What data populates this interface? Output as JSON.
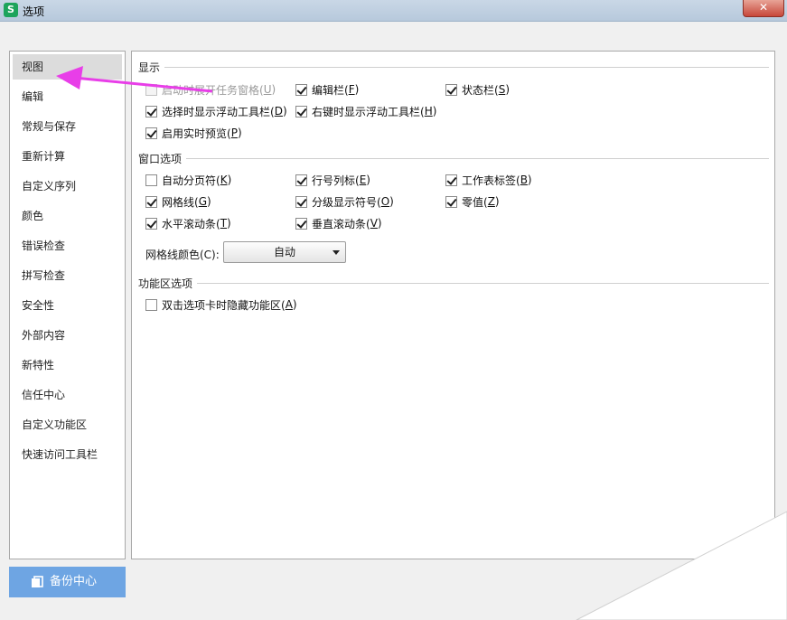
{
  "window": {
    "title": "选项",
    "app_icon": "S",
    "close_label": "✕"
  },
  "sidebar": {
    "items": [
      {
        "label": "视图",
        "selected": true
      },
      {
        "label": "编辑"
      },
      {
        "label": "常规与保存"
      },
      {
        "label": "重新计算"
      },
      {
        "label": "自定义序列"
      },
      {
        "label": "颜色"
      },
      {
        "label": "错误检查"
      },
      {
        "label": "拼写检查"
      },
      {
        "label": "安全性"
      },
      {
        "label": "外部内容"
      },
      {
        "label": "新特性"
      },
      {
        "label": "信任中心"
      },
      {
        "label": "自定义功能区"
      },
      {
        "label": "快速访问工具栏"
      }
    ],
    "backup_button": "备份中心"
  },
  "display": {
    "title": "显示",
    "startup_taskpane": {
      "text": "启动时展开任务窗格(",
      "key": "U",
      "end": ")",
      "checked": false,
      "disabled": true
    },
    "formula_bar": {
      "text": "编辑栏(",
      "key": "F",
      "end": ")",
      "checked": true
    },
    "status_bar": {
      "text": "状态栏(",
      "key": "S",
      "end": ")",
      "checked": true
    },
    "float_toolbar_select": {
      "text": "选择时显示浮动工具栏(",
      "key": "D",
      "end": ")",
      "checked": true
    },
    "float_toolbar_rightclick": {
      "text": "右键时显示浮动工具栏(",
      "key": "H",
      "end": ")",
      "checked": true
    },
    "live_preview": {
      "text": "启用实时预览(",
      "key": "P",
      "end": ")",
      "checked": true
    }
  },
  "window_options": {
    "title": "窗口选项",
    "page_breaks": {
      "text": "自动分页符(",
      "key": "K",
      "end": ")",
      "checked": false
    },
    "row_col_headers": {
      "text": "行号列标(",
      "key": "E",
      "end": ")",
      "checked": true
    },
    "sheet_tabs": {
      "text": "工作表标签(",
      "key": "B",
      "end": ")",
      "checked": true
    },
    "gridlines": {
      "text": "网格线(",
      "key": "G",
      "end": ")",
      "checked": true
    },
    "outline_symbols": {
      "text": "分级显示符号(",
      "key": "O",
      "end": ")",
      "checked": true
    },
    "zero_values": {
      "text": "零值(",
      "key": "Z",
      "end": ")",
      "checked": true
    },
    "h_scroll": {
      "text": "水平滚动条(",
      "key": "T",
      "end": ")",
      "checked": true
    },
    "v_scroll": {
      "text": "垂直滚动条(",
      "key": "V",
      "end": ")",
      "checked": true
    },
    "grid_color_label": "网格线颜色(C):",
    "grid_color_value": "自动"
  },
  "ribbon": {
    "title": "功能区选项",
    "dblclick_hide": {
      "text": "双击选项卡时隐藏功能区(",
      "key": "A",
      "end": ")",
      "checked": false
    }
  },
  "annotation": {
    "arrow_color": "#e83ee8"
  }
}
